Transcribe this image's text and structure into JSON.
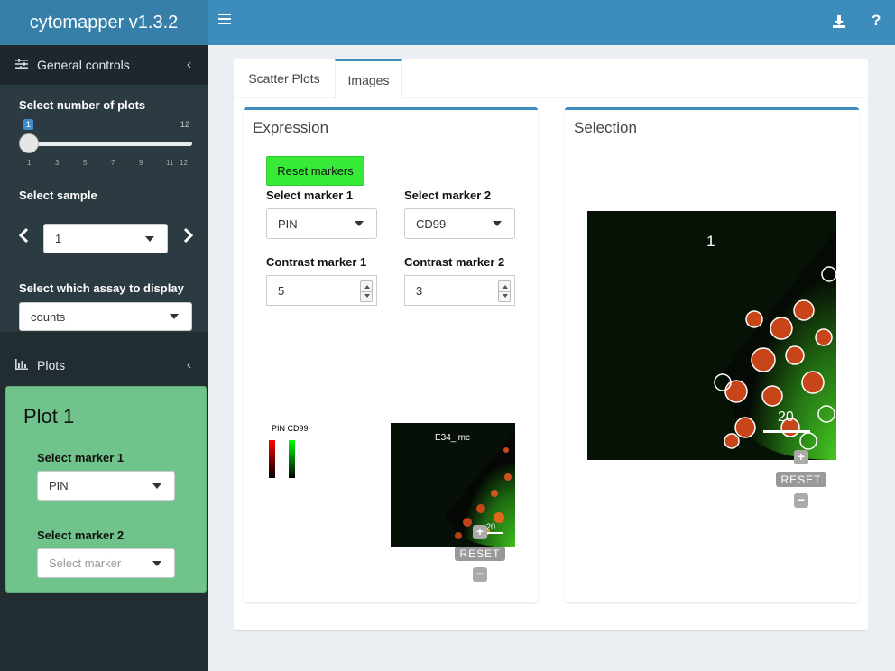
{
  "app": {
    "title": "cytomapper v1.3.2"
  },
  "sidebar": {
    "general_controls": "General controls",
    "num_plots_label": "Select number of plots",
    "num_plots_value": "1",
    "num_plots_max": "12",
    "num_plots_ticks": [
      "1",
      "3",
      "5",
      "7",
      "9",
      "11",
      "12"
    ],
    "sample_label": "Select sample",
    "sample_value": "1",
    "assay_label": "Select which assay to display",
    "assay_value": "counts",
    "plots": "Plots",
    "plot_box": {
      "title": "Plot 1",
      "marker1_label": "Select marker 1",
      "marker1_value": "PIN",
      "marker2_label": "Select marker 2",
      "marker2_placeholder": "Select marker"
    }
  },
  "tabs": [
    "Scatter Plots",
    "Images"
  ],
  "expression": {
    "title": "Expression",
    "reset_label": "Reset markers",
    "marker1_label": "Select marker 1",
    "marker1_value": "PIN",
    "marker2_label": "Select marker 2",
    "marker2_value": "CD99",
    "contrast1_label": "Contrast marker 1",
    "contrast1_value": "5",
    "contrast2_label": "Contrast marker 2",
    "contrast2_value": "3",
    "legend_title": "PIN CD99",
    "image_title": "E34_imc",
    "scale_label": "20",
    "reset_img": "RESET"
  },
  "selection": {
    "title": "Selection",
    "image_label": "1",
    "scale_label": "20",
    "reset_img": "RESET"
  },
  "colors": {
    "header": "#3c8dbc",
    "logo": "#367fa9",
    "sidebar": "#222d32",
    "plot_box": "#6fc38b",
    "reset_button": "#37ea37"
  }
}
